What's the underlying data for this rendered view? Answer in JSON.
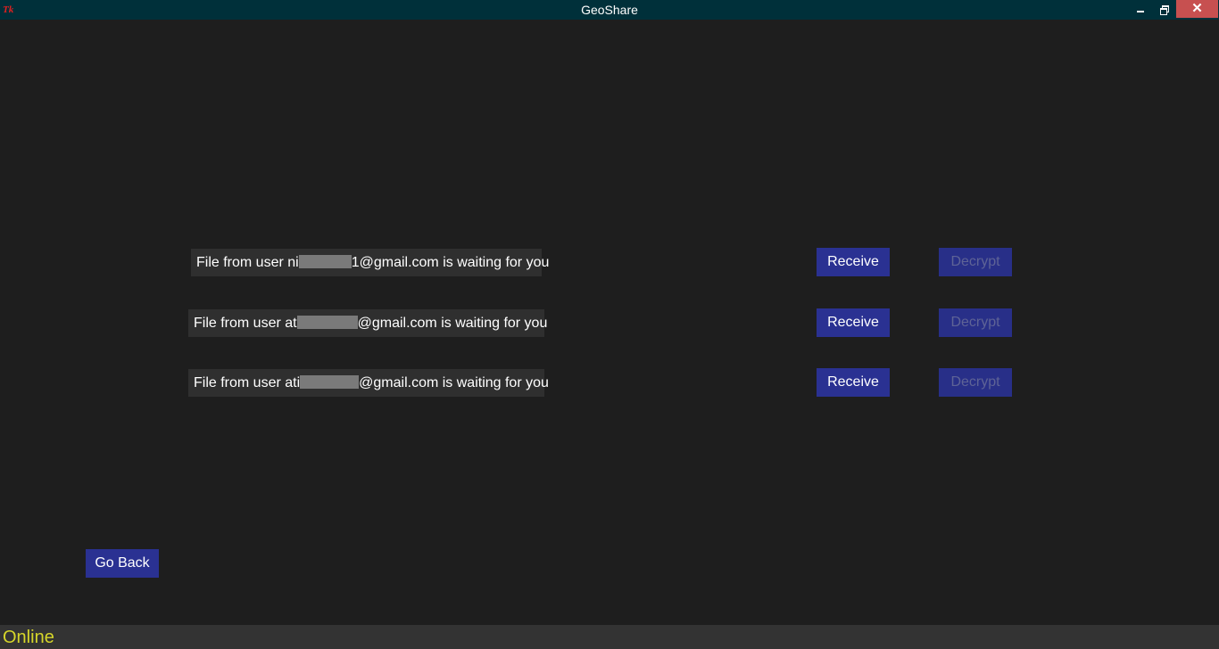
{
  "window": {
    "title": "GeoShare",
    "app_icon": "Tk",
    "minimize_glyph": "minimize-icon",
    "maximize_glyph": "restore-icon",
    "close_glyph": "✕"
  },
  "notifications": [
    {
      "prefix": "File from user ni",
      "mid": "1@gmail.com is waiting for you",
      "suffix": "",
      "receive_label": "Receive",
      "decrypt_label": "Decrypt"
    },
    {
      "prefix": "File from user at",
      "mid": "@gmail.com is waiting for you",
      "suffix": "",
      "receive_label": "Receive",
      "decrypt_label": "Decrypt"
    },
    {
      "prefix": "File from user ati",
      "mid": "@gmail.com is waiting for you",
      "suffix": "",
      "receive_label": "Receive",
      "decrypt_label": "Decrypt"
    }
  ],
  "go_back_label": "Go Back",
  "status": {
    "text": "Online",
    "color": "#d6d62a"
  },
  "colors": {
    "background": "#1e1e1e",
    "titlebar": "#00303a",
    "button": "#2a3192",
    "close_button": "#c75050"
  }
}
